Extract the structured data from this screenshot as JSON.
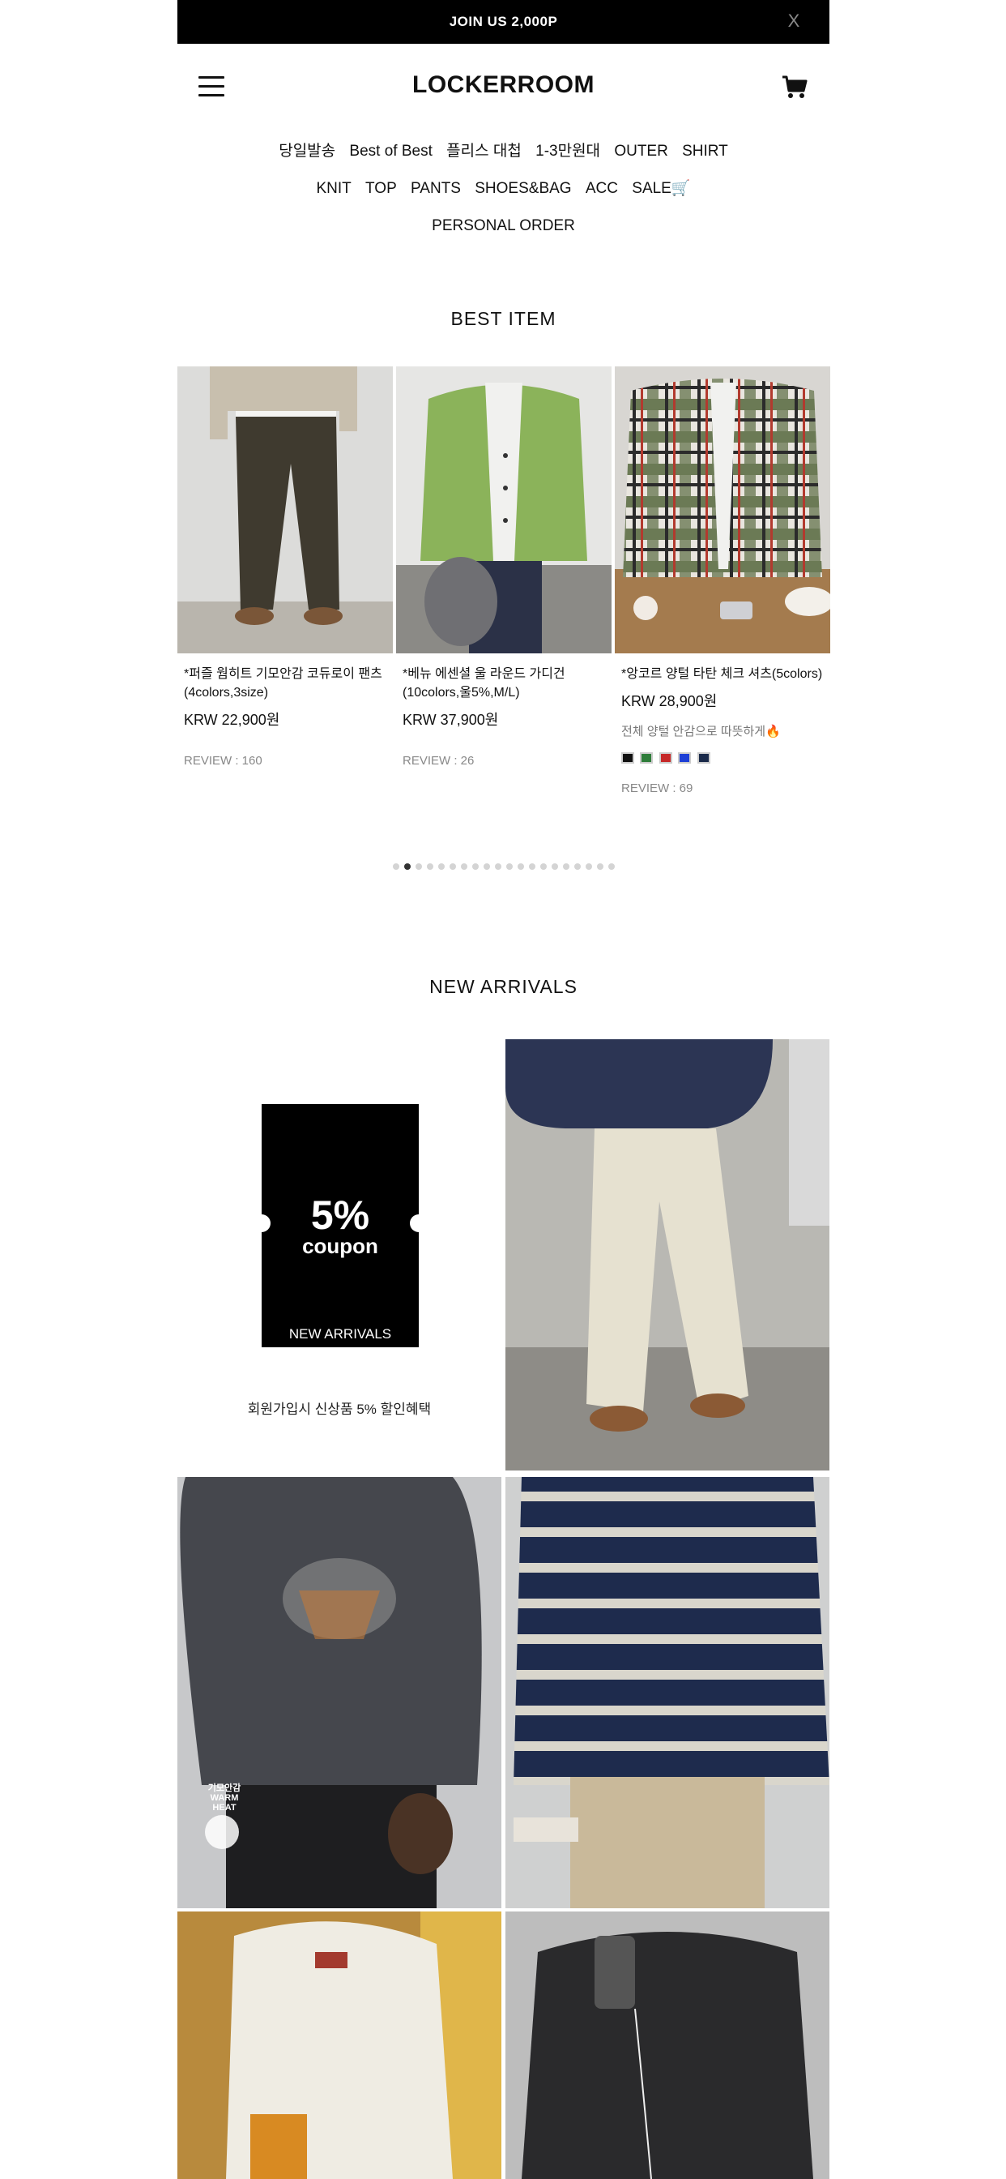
{
  "banner": {
    "text": "JOIN US 2,000P",
    "close": "X"
  },
  "header": {
    "logo": "LOCKERROOM"
  },
  "nav": {
    "rows": [
      [
        "당일발송",
        "Best of Best",
        "플리스 대첩",
        "1-3만원대",
        "OUTER",
        "SHIRT"
      ],
      [
        "KNIT",
        "TOP",
        "PANTS",
        "SHOES&BAG",
        "ACC",
        "SALE🛒"
      ],
      [
        "PERSONAL ORDER"
      ]
    ]
  },
  "best": {
    "title": "BEST ITEM",
    "products": [
      {
        "name": "*퍼즐 웜히트 기모안감 코듀로이 팬츠(4colors,3size)",
        "price": "KRW 22,900원",
        "review": "REVIEW : 160"
      },
      {
        "name": "*베뉴 에센셜 울 라운드 가디건(10colors,울5%,M/L)",
        "price": "KRW 37,900원",
        "review": "REVIEW : 26"
      },
      {
        "name": "*앙코르 양털 타탄 체크 셔츠(5colors)",
        "price": "KRW 28,900원",
        "desc": "전체 양털 안감으로 따뜻하게🔥",
        "review": "REVIEW : 69",
        "swatches": [
          "#111111",
          "#2e7d3a",
          "#c62828",
          "#1d3fd6",
          "#1a2a4a"
        ]
      }
    ],
    "dots_total": 20,
    "dots_active": 1
  },
  "new_arrivals": {
    "title": "NEW ARRIVALS",
    "coupon": {
      "percent": "5%",
      "word": "coupon",
      "label": "NEW ARRIVALS"
    },
    "caption": "회원가입시 신상품 5% 할인혜택",
    "warm_badge": "기모안감\nWARM\nHEAT"
  },
  "colors": {
    "banner": "#000000",
    "text": "#111111",
    "muted": "#888888"
  }
}
